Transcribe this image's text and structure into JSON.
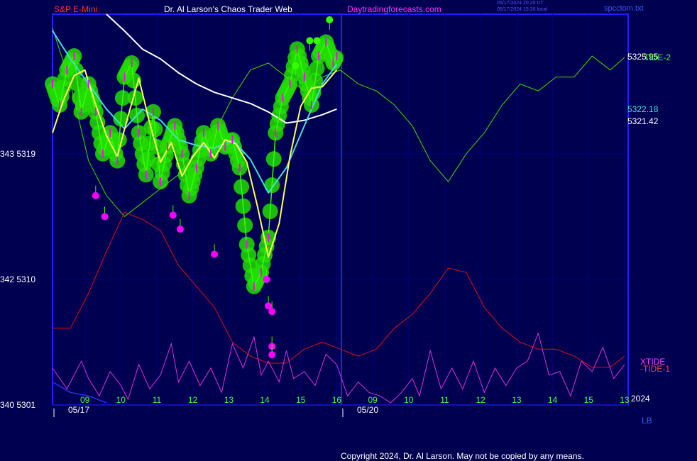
{
  "header": {
    "symbol": "S&P E-Mini",
    "author": "Dr. Al Larson's Chaos Trader Web",
    "site": "Daytradingforecasts.com",
    "time_utc": "05/17/2024 20:20 UT",
    "time_local": "05/17/2024 15:20 local",
    "file": "spcctom.txt"
  },
  "footer": {
    "copyright": "Copyright 2024, Dr. Al Larson. May not be copied by any means.",
    "year": "2024",
    "lb": "LB"
  },
  "colors": {
    "background": "#000050",
    "frame": "#2020ff",
    "price": "#33ff00",
    "glow": "#22dd00",
    "fast_ma": "#ffff55",
    "mid_ma": "#44dddd",
    "slow_ma": "#ffffff",
    "tide2": "#44dd00",
    "tide1": "#dd1111",
    "xtide": "#dd33dd",
    "dot": "#ff00ff"
  },
  "chart_data": {
    "type": "line",
    "title": "S&P E-Mini",
    "ylim": [
      5301,
      5329
    ],
    "y_ticks": [
      {
        "label": "343  5319",
        "value": 5319
      },
      {
        "label": "342  5310",
        "value": 5310
      },
      {
        "label": "340  5301",
        "value": 5301
      }
    ],
    "x_range": [
      0,
      16
    ],
    "x_ticks": [
      {
        "label": "09",
        "x": 0.9
      },
      {
        "label": "10",
        "x": 1.9
      },
      {
        "label": "11",
        "x": 2.9
      },
      {
        "label": "12",
        "x": 3.9
      },
      {
        "label": "13",
        "x": 4.9
      },
      {
        "label": "14",
        "x": 5.9
      },
      {
        "label": "15",
        "x": 6.9
      },
      {
        "label": "16",
        "x": 7.9
      },
      {
        "label": "09",
        "x": 8.9
      },
      {
        "label": "10",
        "x": 9.9
      },
      {
        "label": "11",
        "x": 10.9
      },
      {
        "label": "12",
        "x": 11.9
      },
      {
        "label": "13",
        "x": 12.9
      },
      {
        "label": "14",
        "x": 13.9
      },
      {
        "label": "15",
        "x": 14.9
      },
      {
        "label": "13",
        "x": 15.9
      }
    ],
    "date_labels": [
      {
        "label": "05/17",
        "x": 0.5
      },
      {
        "label": "05/20",
        "x": 8.5
      }
    ],
    "session_divider_x": 7.9,
    "grid": true,
    "value_labels": [
      {
        "text": "5325.95",
        "value": 5325.95,
        "color": "#ffffff"
      },
      {
        "text": "5322.18",
        "value": 5322.18,
        "color": "#44dddd"
      },
      {
        "text": "5321.42",
        "value": 5321.42,
        "color": "#ffffff"
      }
    ],
    "side_labels": [
      {
        "text": "TIDE-2",
        "value": 5325.9,
        "color": "#44ff44",
        "panel": "price"
      },
      {
        "text": "XTIDE",
        "value": 0.55,
        "color": "#ff44ff",
        "panel": "osc"
      },
      {
        "text": "-TIDE-1",
        "value": 0.45,
        "color": "#ff4444",
        "panel": "osc"
      }
    ],
    "series": [
      {
        "name": "S&P E-Mini",
        "x": [
          0.0,
          0.2,
          0.4,
          0.6,
          0.8,
          1.0,
          1.2,
          1.4,
          1.6,
          1.8,
          2.0,
          2.2,
          2.4,
          2.6,
          2.8,
          3.0,
          3.2,
          3.4,
          3.6,
          3.8,
          4.0,
          4.2,
          4.4,
          4.6,
          4.8,
          5.0,
          5.2,
          5.4,
          5.6,
          5.8,
          6.0,
          6.2,
          6.4,
          6.6,
          6.8,
          7.0,
          7.2,
          7.4,
          7.6,
          7.8,
          7.9
        ],
        "values": [
          5324.0,
          5322.5,
          5325.0,
          5326.0,
          5322.0,
          5324.0,
          5322.0,
          5319.0,
          5320.5,
          5318.5,
          5324.5,
          5325.5,
          5320.5,
          5317.5,
          5322.0,
          5317.0,
          5319.5,
          5321.0,
          5319.0,
          5316.0,
          5318.0,
          5320.5,
          5319.0,
          5321.0,
          5319.5,
          5320.0,
          5318.0,
          5312.5,
          5309.5,
          5310.5,
          5313.0,
          5320.5,
          5323.0,
          5324.0,
          5326.5,
          5324.5,
          5322.5,
          5326.0,
          5327.0,
          5325.5,
          5326.0
        ]
      },
      {
        "name": "fast average",
        "x": [
          0.0,
          0.3,
          0.6,
          0.9,
          1.2,
          1.5,
          1.8,
          2.1,
          2.4,
          2.7,
          3.0,
          3.3,
          3.6,
          3.9,
          4.2,
          4.5,
          4.8,
          5.1,
          5.4,
          5.7,
          6.0,
          6.3,
          6.6,
          6.9,
          7.2,
          7.5,
          7.9
        ],
        "values": [
          5320.5,
          5322.8,
          5324.6,
          5325.0,
          5322.5,
          5320.3,
          5318.8,
          5321.7,
          5324.4,
          5321.2,
          5318.4,
          5319.8,
          5317.4,
          5318.8,
          5319.8,
          5318.7,
          5320.0,
          5319.7,
          5318.4,
          5315.2,
          5311.6,
          5314.0,
          5318.8,
          5322.4,
          5323.7,
          5323.8,
          5325.0
        ]
      },
      {
        "name": "mid average",
        "x": [
          0.0,
          0.5,
          1.0,
          1.5,
          2.0,
          2.5,
          3.0,
          3.5,
          4.0,
          4.5,
          5.0,
          5.5,
          6.0,
          6.5,
          7.0,
          7.5,
          7.9
        ],
        "values": [
          5327.8,
          5325.8,
          5324.0,
          5322.2,
          5320.8,
          5322.2,
          5321.4,
          5320.0,
          5319.6,
          5319.4,
          5320.0,
          5318.6,
          5316.2,
          5318.0,
          5321.0,
          5324.0,
          5325.4
        ]
      },
      {
        "name": "slow average",
        "x": [
          1.5,
          2.0,
          2.5,
          3.0,
          3.5,
          4.0,
          4.5,
          5.0,
          5.5,
          6.0,
          6.5,
          7.0,
          7.5,
          7.9
        ],
        "values": [
          5329.0,
          5327.8,
          5326.5,
          5325.8,
          5324.8,
          5324.0,
          5323.4,
          5323.0,
          5322.6,
          5322.0,
          5321.2,
          5321.4,
          5321.8,
          5322.2
        ]
      },
      {
        "name": "TIDE-2",
        "x": [
          0.0,
          0.5,
          1.0,
          1.5,
          2.0,
          2.5,
          3.0,
          3.5,
          4.0,
          4.5,
          5.0,
          5.5,
          6.0,
          6.5,
          7.0,
          7.5,
          8.0,
          8.5,
          9.0,
          9.5,
          10.0,
          10.5,
          11.0,
          11.5,
          12.0,
          12.5,
          13.0,
          13.5,
          14.0,
          14.5,
          15.0,
          15.5,
          15.9
        ],
        "values": [
          5328.0,
          5324.0,
          5318.5,
          5316.0,
          5314.5,
          5315.5,
          5316.5,
          5317.5,
          5319.0,
          5320.5,
          5323.0,
          5325.0,
          5325.5,
          5324.5,
          5323.5,
          5324.5,
          5325.0,
          5324.0,
          5323.5,
          5322.5,
          5321.0,
          5318.5,
          5317.0,
          5319.0,
          5320.5,
          5322.5,
          5324.0,
          5323.5,
          5324.5,
          5324.5,
          5326.0,
          5325.0,
          5325.9
        ]
      },
      {
        "name": "-TIDE-1",
        "x": [
          0.0,
          0.5,
          1.0,
          1.5,
          2.0,
          2.5,
          3.0,
          3.5,
          4.0,
          4.5,
          5.0,
          5.5,
          6.0,
          6.5,
          7.0,
          7.5,
          8.0,
          8.5,
          9.0,
          9.5,
          10.0,
          10.5,
          11.0,
          11.5,
          12.0,
          12.5,
          13.0,
          13.5,
          14.0,
          14.5,
          15.0,
          15.5,
          15.9
        ],
        "values": [
          5306.5,
          5306.5,
          5309.0,
          5312.0,
          5314.8,
          5314.3,
          5313.5,
          5311.0,
          5309.5,
          5308.0,
          5305.5,
          5304.5,
          5304.0,
          5304.0,
          5305.0,
          5305.5,
          5305.0,
          5304.5,
          5305.0,
          5306.5,
          5307.5,
          5309.0,
          5310.8,
          5310.5,
          5308.0,
          5306.5,
          5305.5,
          5305.0,
          5305.0,
          5304.5,
          5303.7,
          5303.7,
          5304.5
        ]
      },
      {
        "name": "XTIDE",
        "x": [
          0.0,
          0.4,
          0.8,
          1.0,
          1.3,
          1.6,
          1.9,
          2.1,
          2.4,
          2.7,
          3.0,
          3.3,
          3.5,
          3.8,
          4.1,
          4.4,
          4.7,
          5.0,
          5.3,
          5.6,
          5.8,
          6.0,
          6.3,
          6.5,
          6.7,
          7.0,
          7.3,
          7.6,
          7.9,
          8.2,
          8.5,
          8.8,
          9.1,
          9.4,
          9.7,
          10.0,
          10.2,
          10.5,
          10.8,
          11.1,
          11.4,
          11.7,
          12.0,
          12.3,
          12.6,
          12.9,
          13.2,
          13.5,
          13.8,
          14.1,
          14.4,
          14.7,
          15.0,
          15.3,
          15.6,
          15.9
        ],
        "values": [
          0.5,
          0.2,
          0.6,
          0.35,
          0.1,
          0.45,
          0.25,
          0.05,
          0.55,
          0.2,
          0.4,
          0.85,
          0.3,
          0.6,
          0.25,
          0.5,
          0.15,
          0.85,
          0.5,
          0.95,
          0.4,
          0.6,
          0.3,
          0.75,
          0.35,
          0.45,
          0.25,
          0.7,
          0.55,
          0.1,
          0.3,
          0.15,
          0.1,
          0.0,
          0.15,
          0.35,
          0.1,
          0.75,
          0.2,
          0.5,
          0.2,
          0.6,
          0.15,
          0.5,
          0.25,
          0.5,
          0.6,
          1.0,
          0.4,
          0.45,
          0.1,
          0.6,
          0.45,
          0.8,
          0.35,
          0.55
        ]
      },
      {
        "name": "prev average",
        "x": [
          0.0,
          0.5,
          1.0,
          1.5
        ],
        "values": [
          0.3,
          0.15,
          0.1,
          0.0
        ]
      }
    ],
    "low_markers": {
      "x": [
        1.2,
        1.45,
        3.35,
        3.55,
        4.5,
        5.95,
        6.0,
        6.1,
        6.1,
        6.1
      ],
      "values": [
        5316.0,
        5314.5,
        5314.6,
        5313.6,
        5311.8,
        5310.0,
        5308.1,
        5307.7,
        5305.2,
        5304.6
      ]
    },
    "high_markers": {
      "x": [
        6.75,
        7.15,
        7.35,
        7.7
      ],
      "values": [
        5325.3,
        5327.1,
        5327.1,
        5328.6
      ]
    }
  }
}
